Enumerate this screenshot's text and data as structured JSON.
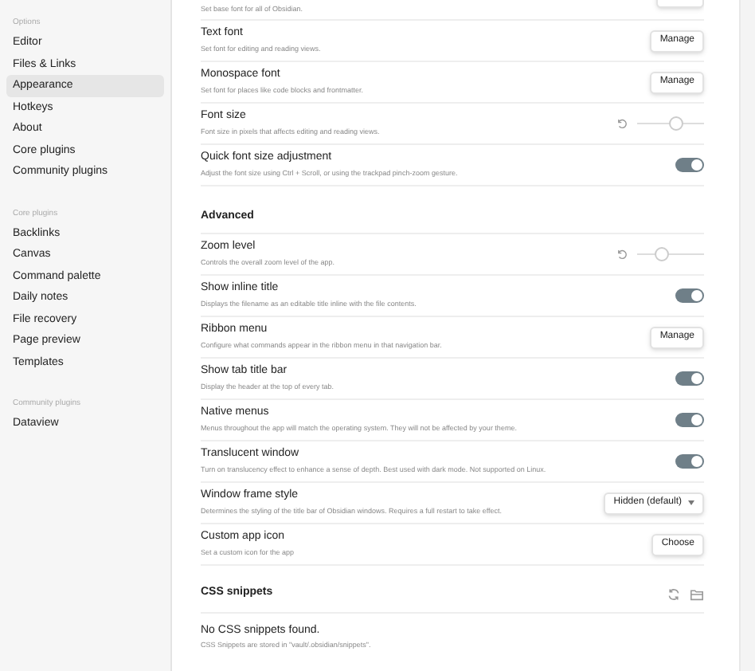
{
  "sidebar": {
    "groups": [
      {
        "header": "Options",
        "items": [
          {
            "label": "Editor",
            "selected": false
          },
          {
            "label": "Files & Links",
            "selected": false
          },
          {
            "label": "Appearance",
            "selected": true
          },
          {
            "label": "Hotkeys",
            "selected": false
          },
          {
            "label": "About",
            "selected": false
          },
          {
            "label": "Core plugins",
            "selected": false
          },
          {
            "label": "Community plugins",
            "selected": false
          }
        ]
      },
      {
        "header": "Core plugins",
        "items": [
          {
            "label": "Backlinks",
            "selected": false
          },
          {
            "label": "Canvas",
            "selected": false
          },
          {
            "label": "Command palette",
            "selected": false
          },
          {
            "label": "Daily notes",
            "selected": false
          },
          {
            "label": "File recovery",
            "selected": false
          },
          {
            "label": "Page preview",
            "selected": false
          },
          {
            "label": "Templates",
            "selected": false
          }
        ]
      },
      {
        "header": "Community plugins",
        "items": [
          {
            "label": "Dataview",
            "selected": false
          }
        ]
      }
    ]
  },
  "settings": [
    {
      "kind": "cut",
      "description": "Set base font for all of Obsidian."
    },
    {
      "kind": "button",
      "title": "Text font",
      "description": "Set font for editing and reading views.",
      "button": "Manage"
    },
    {
      "kind": "button",
      "title": "Monospace font",
      "description": "Set font for places like code blocks and frontmatter.",
      "button": "Manage"
    },
    {
      "kind": "slider",
      "title": "Font size",
      "description": "Font size in pixels that affects editing and reading views.",
      "level": 0.58
    },
    {
      "kind": "toggle",
      "title": "Quick font size adjustment",
      "description": "Adjust the font size using Ctrl + Scroll, or using the trackpad pinch-zoom gesture.",
      "on": true
    },
    {
      "kind": "heading",
      "title": "Advanced"
    },
    {
      "kind": "slider",
      "title": "Zoom level",
      "description": "Controls the overall zoom level of the app.",
      "level": 0.38
    },
    {
      "kind": "toggle",
      "title": "Show inline title",
      "description": "Displays the filename as an editable title inline with the file contents.",
      "on": true
    },
    {
      "kind": "button",
      "title": "Ribbon menu",
      "description": "Configure what commands appear in the ribbon menu in that navigation bar.",
      "button": "Manage"
    },
    {
      "kind": "toggle",
      "title": "Show tab title bar",
      "description": "Display the header at the top of every tab.",
      "on": true
    },
    {
      "kind": "toggle",
      "title": "Native menus",
      "description": "Menus throughout the app will match the operating system. They will not be affected by your theme.",
      "on": true
    },
    {
      "kind": "toggle",
      "title": "Translucent window",
      "description": "Turn on translucency effect to enhance a sense of depth. Best used with dark mode. Not supported on Linux.",
      "on": true
    },
    {
      "kind": "dropdown",
      "title": "Window frame style",
      "description": "Determines the styling of the title bar of Obsidian windows. Requires a full restart to take effect.",
      "value": "Hidden (default)"
    },
    {
      "kind": "button",
      "title": "Custom app icon",
      "description": "Set a custom icon for the app",
      "button": "Choose"
    },
    {
      "kind": "snippets",
      "title": "CSS snippets"
    },
    {
      "kind": "info",
      "title": "No CSS snippets found.",
      "description": "CSS Snippets are stored in \"vault/.obsidian/snippets\"."
    }
  ]
}
